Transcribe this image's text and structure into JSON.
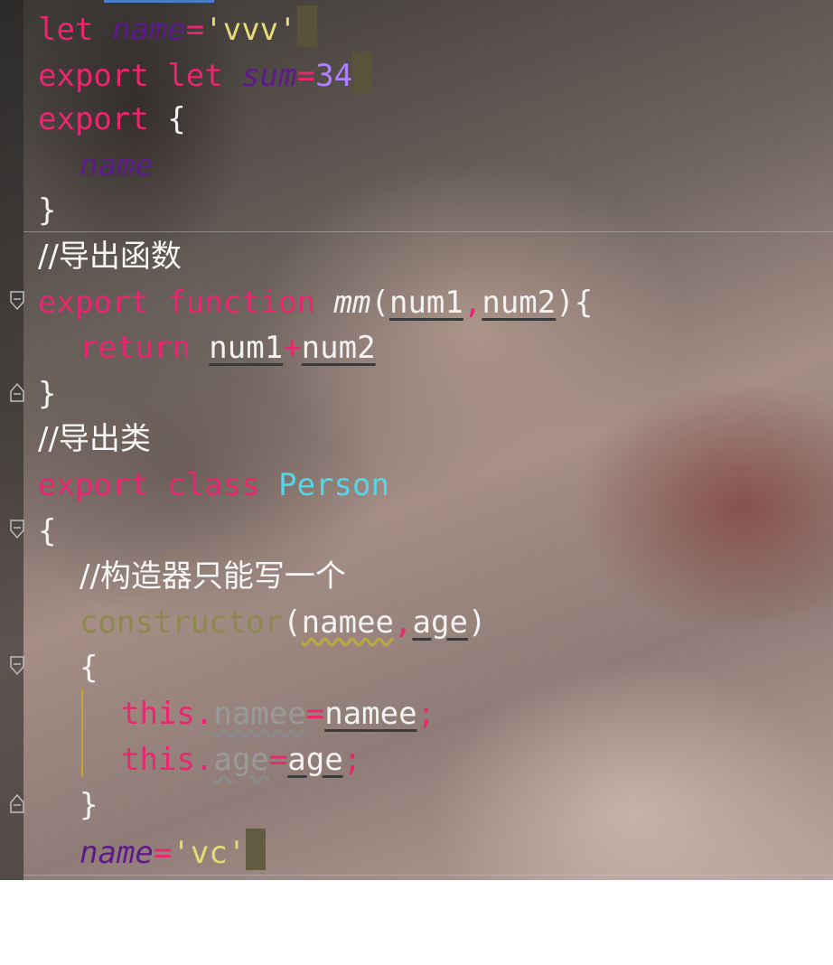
{
  "editor": {
    "lines": [
      {
        "id": "l1",
        "tokens": [
          "let ",
          "name",
          "=",
          "'vvv'"
        ]
      },
      {
        "id": "l2",
        "tokens": [
          "export ",
          "let ",
          "sum",
          "=",
          "34"
        ]
      },
      {
        "id": "l3",
        "tokens": [
          "export ",
          "{"
        ]
      },
      {
        "id": "l4",
        "tokens": [
          "name"
        ]
      },
      {
        "id": "l5",
        "tokens": [
          "}"
        ]
      },
      {
        "id": "l6",
        "tokens": [
          "//导出函数"
        ]
      },
      {
        "id": "l7",
        "tokens": [
          "export ",
          "function ",
          "mm",
          "(",
          "num1",
          ",",
          "num2",
          "){"
        ]
      },
      {
        "id": "l8",
        "tokens": [
          "return ",
          "num1",
          "+",
          "num2"
        ]
      },
      {
        "id": "l9",
        "tokens": [
          "}"
        ]
      },
      {
        "id": "l10",
        "tokens": [
          "//导出类"
        ]
      },
      {
        "id": "l11",
        "tokens": [
          "export ",
          "class ",
          "Person"
        ]
      },
      {
        "id": "l12",
        "tokens": [
          "{"
        ]
      },
      {
        "id": "l13",
        "tokens": [
          "//构造器只能写一个"
        ]
      },
      {
        "id": "l14",
        "tokens": [
          "constructor",
          "(",
          "namee",
          ",",
          "age",
          ")"
        ]
      },
      {
        "id": "l15",
        "tokens": [
          "{"
        ]
      },
      {
        "id": "l16",
        "tokens": [
          "this.",
          "namee",
          "=",
          "namee",
          ";"
        ]
      },
      {
        "id": "l17",
        "tokens": [
          "this.",
          "age",
          "=",
          "age",
          ";"
        ]
      },
      {
        "id": "l18",
        "tokens": [
          "}"
        ]
      },
      {
        "id": "l19",
        "tokens": [
          "name",
          "=",
          "'vc'"
        ]
      }
    ]
  },
  "colors": {
    "keyword": "#e9266f",
    "variable": "#5d1a8a",
    "string": "#e6db74",
    "number": "#ae81ff",
    "class_name": "#53d6e8",
    "constructor": "#8b8a4a",
    "indent_guide": "#c9a227"
  },
  "icons": {
    "fold_open": "fold-marker-icon",
    "fold_close": "fold-end-icon"
  }
}
